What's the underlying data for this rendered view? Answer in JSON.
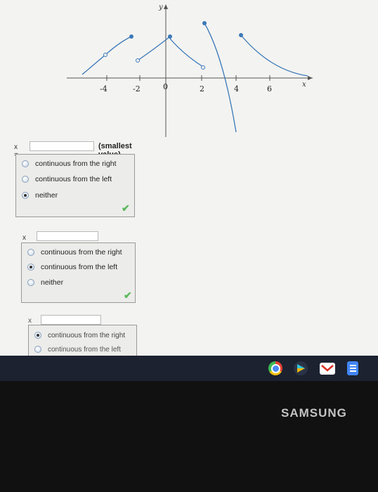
{
  "graph": {
    "axis_labels": {
      "x": "x",
      "y": "y"
    },
    "tick_labels": [
      "-4",
      "-2",
      "0",
      "2",
      "4",
      "6"
    ]
  },
  "questions": [
    {
      "x_label": "x =",
      "hint": "(smallest value)",
      "options": [
        "continuous from the right",
        "continuous from the left",
        "neither"
      ],
      "selected": 2,
      "correct_mark": "✔"
    },
    {
      "x_label": "x =",
      "options": [
        "continuous from the right",
        "continuous from the left",
        "neither"
      ],
      "selected": 1,
      "correct_mark": "✔"
    },
    {
      "x_label": "x =",
      "options": [
        "continuous from the right",
        "continuous from the left"
      ],
      "selected": 0
    }
  ],
  "taskbar": {
    "icons": [
      "chrome-icon",
      "play-store-icon",
      "gmail-icon",
      "docs-icon"
    ]
  },
  "device": {
    "brand": "SAMSUNG"
  },
  "colors": {
    "curve": "#3b78b8",
    "check": "#5cb85c",
    "taskbar": "#1c2230"
  }
}
